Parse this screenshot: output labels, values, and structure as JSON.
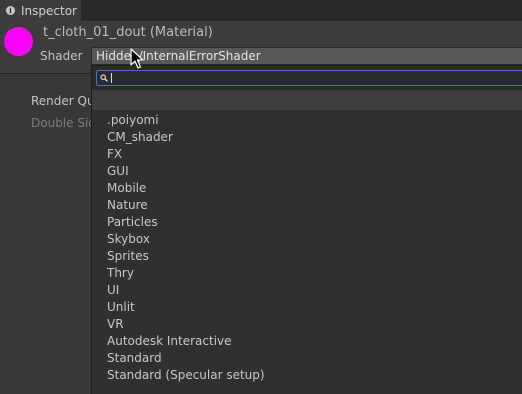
{
  "tab": {
    "icon": "info-icon",
    "label": "Inspector"
  },
  "header": {
    "title": "t_cloth_01_dout (Material)",
    "preview_color": "#ff00ff",
    "shader_label": "Shader",
    "shader_value": "Hidden/InternalErrorShader"
  },
  "properties": {
    "render_queue_label": "Render Qu",
    "double_sided_label": "Double Sid"
  },
  "popup": {
    "search_value": "",
    "items": [
      ".poiyomi",
      "CM_shader",
      "FX",
      "GUI",
      "Mobile",
      "Nature",
      "Particles",
      "Skybox",
      "Sprites",
      "Thry",
      "UI",
      "Unlit",
      "VR",
      "Autodesk Interactive",
      "Standard",
      "Standard (Specular setup)"
    ]
  }
}
